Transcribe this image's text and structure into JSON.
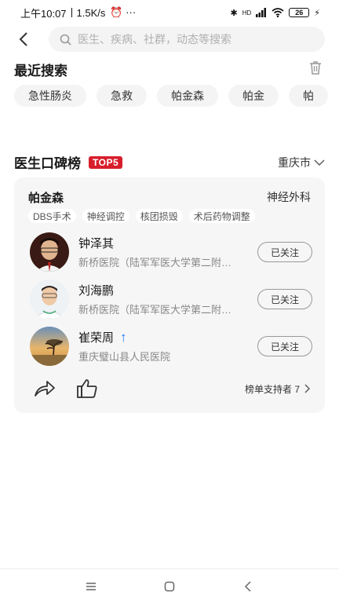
{
  "status_bar": {
    "time": "上午10:07",
    "speed": "1.5K/s",
    "extra": "⏰ ···",
    "network": "HD",
    "battery": "26"
  },
  "search": {
    "placeholder": "医生、疾病、社群，动态等搜索"
  },
  "recent": {
    "title": "最近搜索",
    "items": [
      "急性肠炎",
      "急救",
      "帕金森",
      "帕金",
      "帕"
    ]
  },
  "ranking": {
    "title": "医生口碑榜",
    "badge": "TOP5",
    "city": "重庆市",
    "card": {
      "disease": "帕金森",
      "department": "神经外科",
      "tags": [
        "DBS手术",
        "神经调控",
        "核团损毁",
        "术后药物调整"
      ],
      "doctors": [
        {
          "name": "钟泽其",
          "hospital": "新桥医院（陆军军医大学第二附属医院）",
          "follow_label": "已关注"
        },
        {
          "name": "刘海鹏",
          "hospital": "新桥医院（陆军军医大学第二附属医院）",
          "follow_label": "已关注"
        },
        {
          "name": "崔荣周",
          "hospital": "重庆璧山县人民医院",
          "follow_label": "已关注",
          "trend": "↑"
        }
      ],
      "supporters": "榜单支持者 7"
    }
  },
  "colors": {
    "accent_red": "#d81e2c",
    "trend_blue": "#1677ff"
  }
}
